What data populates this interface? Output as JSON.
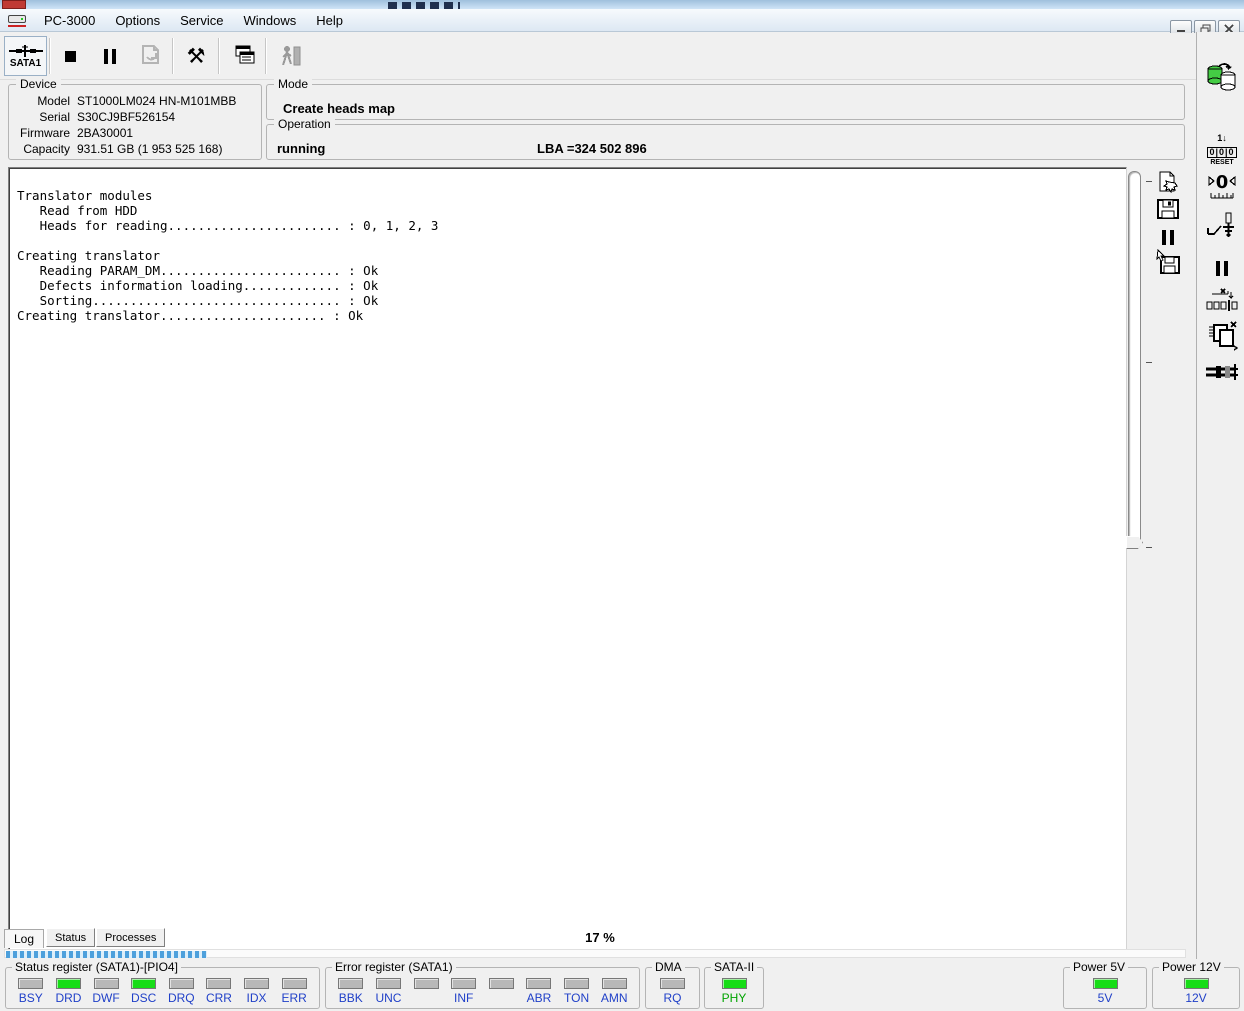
{
  "menu": {
    "items": [
      {
        "label": "PC-3000"
      },
      {
        "label": "Options"
      },
      {
        "label": "Service"
      },
      {
        "label": "Windows"
      },
      {
        "label": "Help"
      }
    ]
  },
  "toolbar": {
    "port_label": "SATA1"
  },
  "device": {
    "legend": "Device",
    "fields": [
      {
        "label": "Model",
        "value": "ST1000LM024 HN-M101MBB"
      },
      {
        "label": "Serial",
        "value": "S30CJ9BF526154"
      },
      {
        "label": "Firmware",
        "value": "2BA30001"
      },
      {
        "label": "Capacity",
        "value": "931.51 GB (1 953 525 168)"
      }
    ]
  },
  "mode": {
    "legend": "Mode",
    "value": "Create heads map"
  },
  "operation": {
    "legend": "Operation",
    "status": "running",
    "lba": "LBA =324 502 896"
  },
  "log": {
    "lines": [
      "Translator modules",
      "   Read from HDD",
      "   Heads for reading....................... : 0, 1, 2, 3",
      "",
      "Creating translator",
      "   Reading PARAM_DM........................ : Ok",
      "   Defects information loading............. : Ok",
      "   Sorting................................. : Ok",
      "Creating translator...................... : Ok"
    ]
  },
  "tabs": {
    "log": "Log",
    "status": "Status",
    "processes": "Processes"
  },
  "progress": {
    "percent_label": "17 %",
    "percent": 17
  },
  "icons": {
    "reset_top": "1↓",
    "reset_digits": "0|0|0",
    "reset_label": "RESET",
    "tools_glyph": "⚒",
    "close_glyph": "✕"
  },
  "registers": {
    "status": {
      "title": "Status register (SATA1)-[PIO4]",
      "leds": [
        {
          "label": "BSY",
          "state": "off"
        },
        {
          "label": "DRD",
          "state": "on"
        },
        {
          "label": "DWF",
          "state": "off"
        },
        {
          "label": "DSC",
          "state": "on"
        },
        {
          "label": "DRQ",
          "state": "off"
        },
        {
          "label": "CRR",
          "state": "off"
        },
        {
          "label": "IDX",
          "state": "off"
        },
        {
          "label": "ERR",
          "state": "off"
        }
      ]
    },
    "error": {
      "title": "Error register (SATA1)",
      "leds": [
        {
          "label": "BBK",
          "state": "off"
        },
        {
          "label": "UNC",
          "state": "off"
        },
        {
          "label": "",
          "state": "off"
        },
        {
          "label": "INF",
          "state": "off"
        },
        {
          "label": "",
          "state": "off"
        },
        {
          "label": "ABR",
          "state": "off"
        },
        {
          "label": "TON",
          "state": "off"
        },
        {
          "label": "AMN",
          "state": "off"
        }
      ]
    },
    "dma": {
      "title": "DMA",
      "led": {
        "label": "RQ",
        "state": "off"
      }
    },
    "sata2": {
      "title": "SATA-II",
      "led": {
        "label": "PHY",
        "state": "on"
      }
    },
    "power5": {
      "title": "Power 5V",
      "led": {
        "label": "5V",
        "state": "on"
      }
    },
    "power12": {
      "title": "Power 12V",
      "led": {
        "label": "12V",
        "state": "on"
      }
    }
  },
  "colors": {
    "led_on": "#17dd17",
    "led_off": "#b8b8b8",
    "led_label_blue": "#2040c8",
    "phy_label_green": "#00a400",
    "progress_blue": "#4da0dc",
    "drive_icon_green": "#44cc44"
  }
}
